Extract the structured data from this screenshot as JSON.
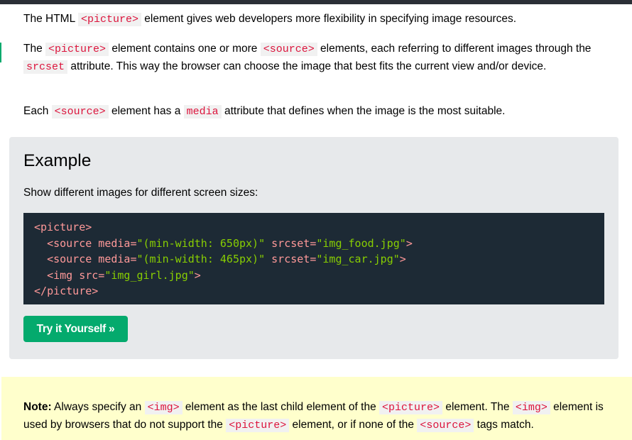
{
  "paragraphs": {
    "p1": {
      "before": "The HTML ",
      "code1": "<picture>",
      "after": " element gives web developers more flexibility in specifying image resources."
    },
    "p2": {
      "before": "The ",
      "code1": "<picture>",
      "mid1": " element contains one or more ",
      "code2": "<source>",
      "mid2": " elements, each referring to different images through the ",
      "code3": "srcset",
      "after": " attribute. This way the browser can choose the image that best fits the current view and/or device."
    },
    "p3": {
      "before": "Each ",
      "code1": "<source>",
      "mid1": " element has a ",
      "code2": "media",
      "after": " attribute that defines when the image is the most suitable."
    }
  },
  "example": {
    "title": "Example",
    "description": "Show different images for different screen sizes:",
    "code_lines": [
      {
        "indent": "",
        "open": "<",
        "tag": "picture",
        "attrs": "",
        "close": ">"
      },
      {
        "indent": "  ",
        "open": "<",
        "tag": "source",
        "a1name": " media=",
        "a1val": "\"(min-width: 650px)\"",
        "a2name": " srcset=",
        "a2val": "\"img_food.jpg\"",
        "close": ">"
      },
      {
        "indent": "  ",
        "open": "<",
        "tag": "source",
        "a1name": " media=",
        "a1val": "\"(min-width: 465px)\"",
        "a2name": " srcset=",
        "a2val": "\"img_car.jpg\"",
        "close": ">"
      },
      {
        "indent": "  ",
        "open": "<",
        "tag": "img",
        "a1name": " src=",
        "a1val": "\"img_girl.jpg\"",
        "close": ">"
      },
      {
        "indent": "",
        "open": "</",
        "tag": "picture",
        "close": ">"
      }
    ],
    "button_label": "Try it Yourself »"
  },
  "note": {
    "label": "Note:",
    "t1": " Always specify an ",
    "c1": "<img>",
    "t2": " element as the last child element of the ",
    "c2": "<picture>",
    "t3": " element. The ",
    "c3": "<img>",
    "t4": " element is used by browsers that do not support the ",
    "c4": "<picture>",
    "t5": " element, or if none of the ",
    "c5": "<source>",
    "t6": " tags match."
  },
  "colors": {
    "accent": "#04aa6d",
    "code_bg": "#1d2a35",
    "inline_code": "#dc143c",
    "note_bg": "#ffffcc",
    "example_bg": "#e7e9eb"
  }
}
